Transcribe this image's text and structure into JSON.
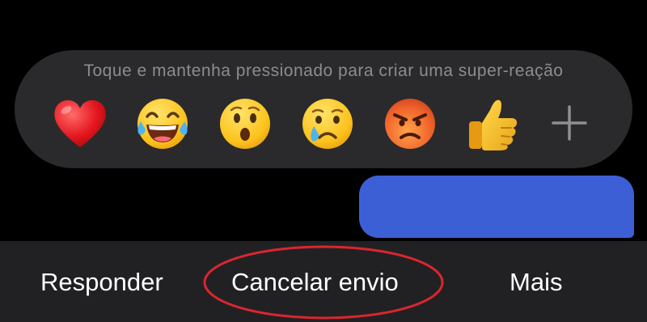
{
  "reaction_tray": {
    "hint": "Toque e mantenha pressionado para criar uma super-reação",
    "reactions": [
      {
        "name": "heart-icon",
        "glyph": "heart"
      },
      {
        "name": "laughing-tears-icon",
        "glyph": "tears-of-joy"
      },
      {
        "name": "surprised-face-icon",
        "glyph": "wow"
      },
      {
        "name": "crying-face-icon",
        "glyph": "sad"
      },
      {
        "name": "angry-face-icon",
        "glyph": "angry"
      },
      {
        "name": "thumbs-up-icon",
        "glyph": "like"
      }
    ],
    "more_icon": "plus-icon"
  },
  "actions": {
    "reply": "Responder",
    "unsend": "Cancelar envio",
    "more": "Mais"
  },
  "colors": {
    "background": "#000000",
    "tray": "#2a2a2c",
    "bubble": "#3d5fd6",
    "action_bar": "#212123",
    "highlight": "#d9262f"
  }
}
